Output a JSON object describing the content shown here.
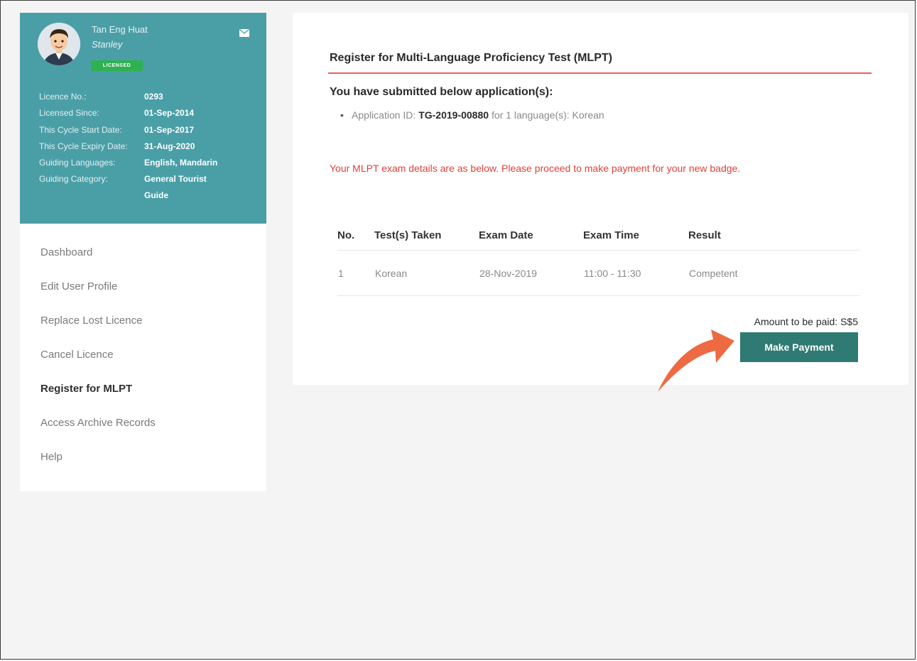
{
  "profile": {
    "name": "Tan Eng Huat",
    "nickname": "Stanley",
    "status_badge": "LICENSED",
    "avatar_icon": "person-avatar-icon",
    "mail_icon": "envelope-icon",
    "fields": [
      {
        "label": "Licence No.:",
        "value": "0293"
      },
      {
        "label": "Licensed Since:",
        "value": "01-Sep-2014"
      },
      {
        "label": "This Cycle Start Date:",
        "value": "01-Sep-2017"
      },
      {
        "label": "This Cycle Expiry Date:",
        "value": "31-Aug-2020"
      },
      {
        "label": "Guiding Languages:",
        "value": "English, Mandarin"
      },
      {
        "label": "Guiding Category:",
        "value": "General Tourist Guide"
      }
    ]
  },
  "menu": {
    "items": [
      {
        "label": "Dashboard"
      },
      {
        "label": "Edit User Profile"
      },
      {
        "label": "Replace Lost Licence"
      },
      {
        "label": "Cancel Licence"
      },
      {
        "label": "Register for MLPT",
        "active": true
      },
      {
        "label": "Access Archive Records"
      },
      {
        "label": "Help"
      }
    ]
  },
  "main": {
    "title": "Register for Multi-Language Proficiency Test (MLPT)",
    "submitted_heading": "You have submitted below application(s):",
    "application": {
      "prefix": "Application ID:",
      "id": "TG-2019-00880",
      "suffix": "for 1 language(s): Korean"
    },
    "notice": "Your MLPT exam details are as below. Please proceed to make payment for your new badge.",
    "table": {
      "headers": [
        "No.",
        "Test(s) Taken",
        "Exam Date",
        "Exam Time",
        "Result"
      ],
      "rows": [
        [
          "1",
          "Korean",
          "28-Nov-2019",
          "11:00 - 11:30",
          "Competent"
        ]
      ]
    },
    "amount_text": "Amount to be paid: S$5",
    "pay_button": "Make Payment"
  },
  "colors": {
    "profile_bg": "#4a9fa7",
    "badge_green": "#2fb14f",
    "accent_red": "#e2403a",
    "button_teal": "#2f7a72",
    "arrow_orange": "#ee6a43"
  }
}
